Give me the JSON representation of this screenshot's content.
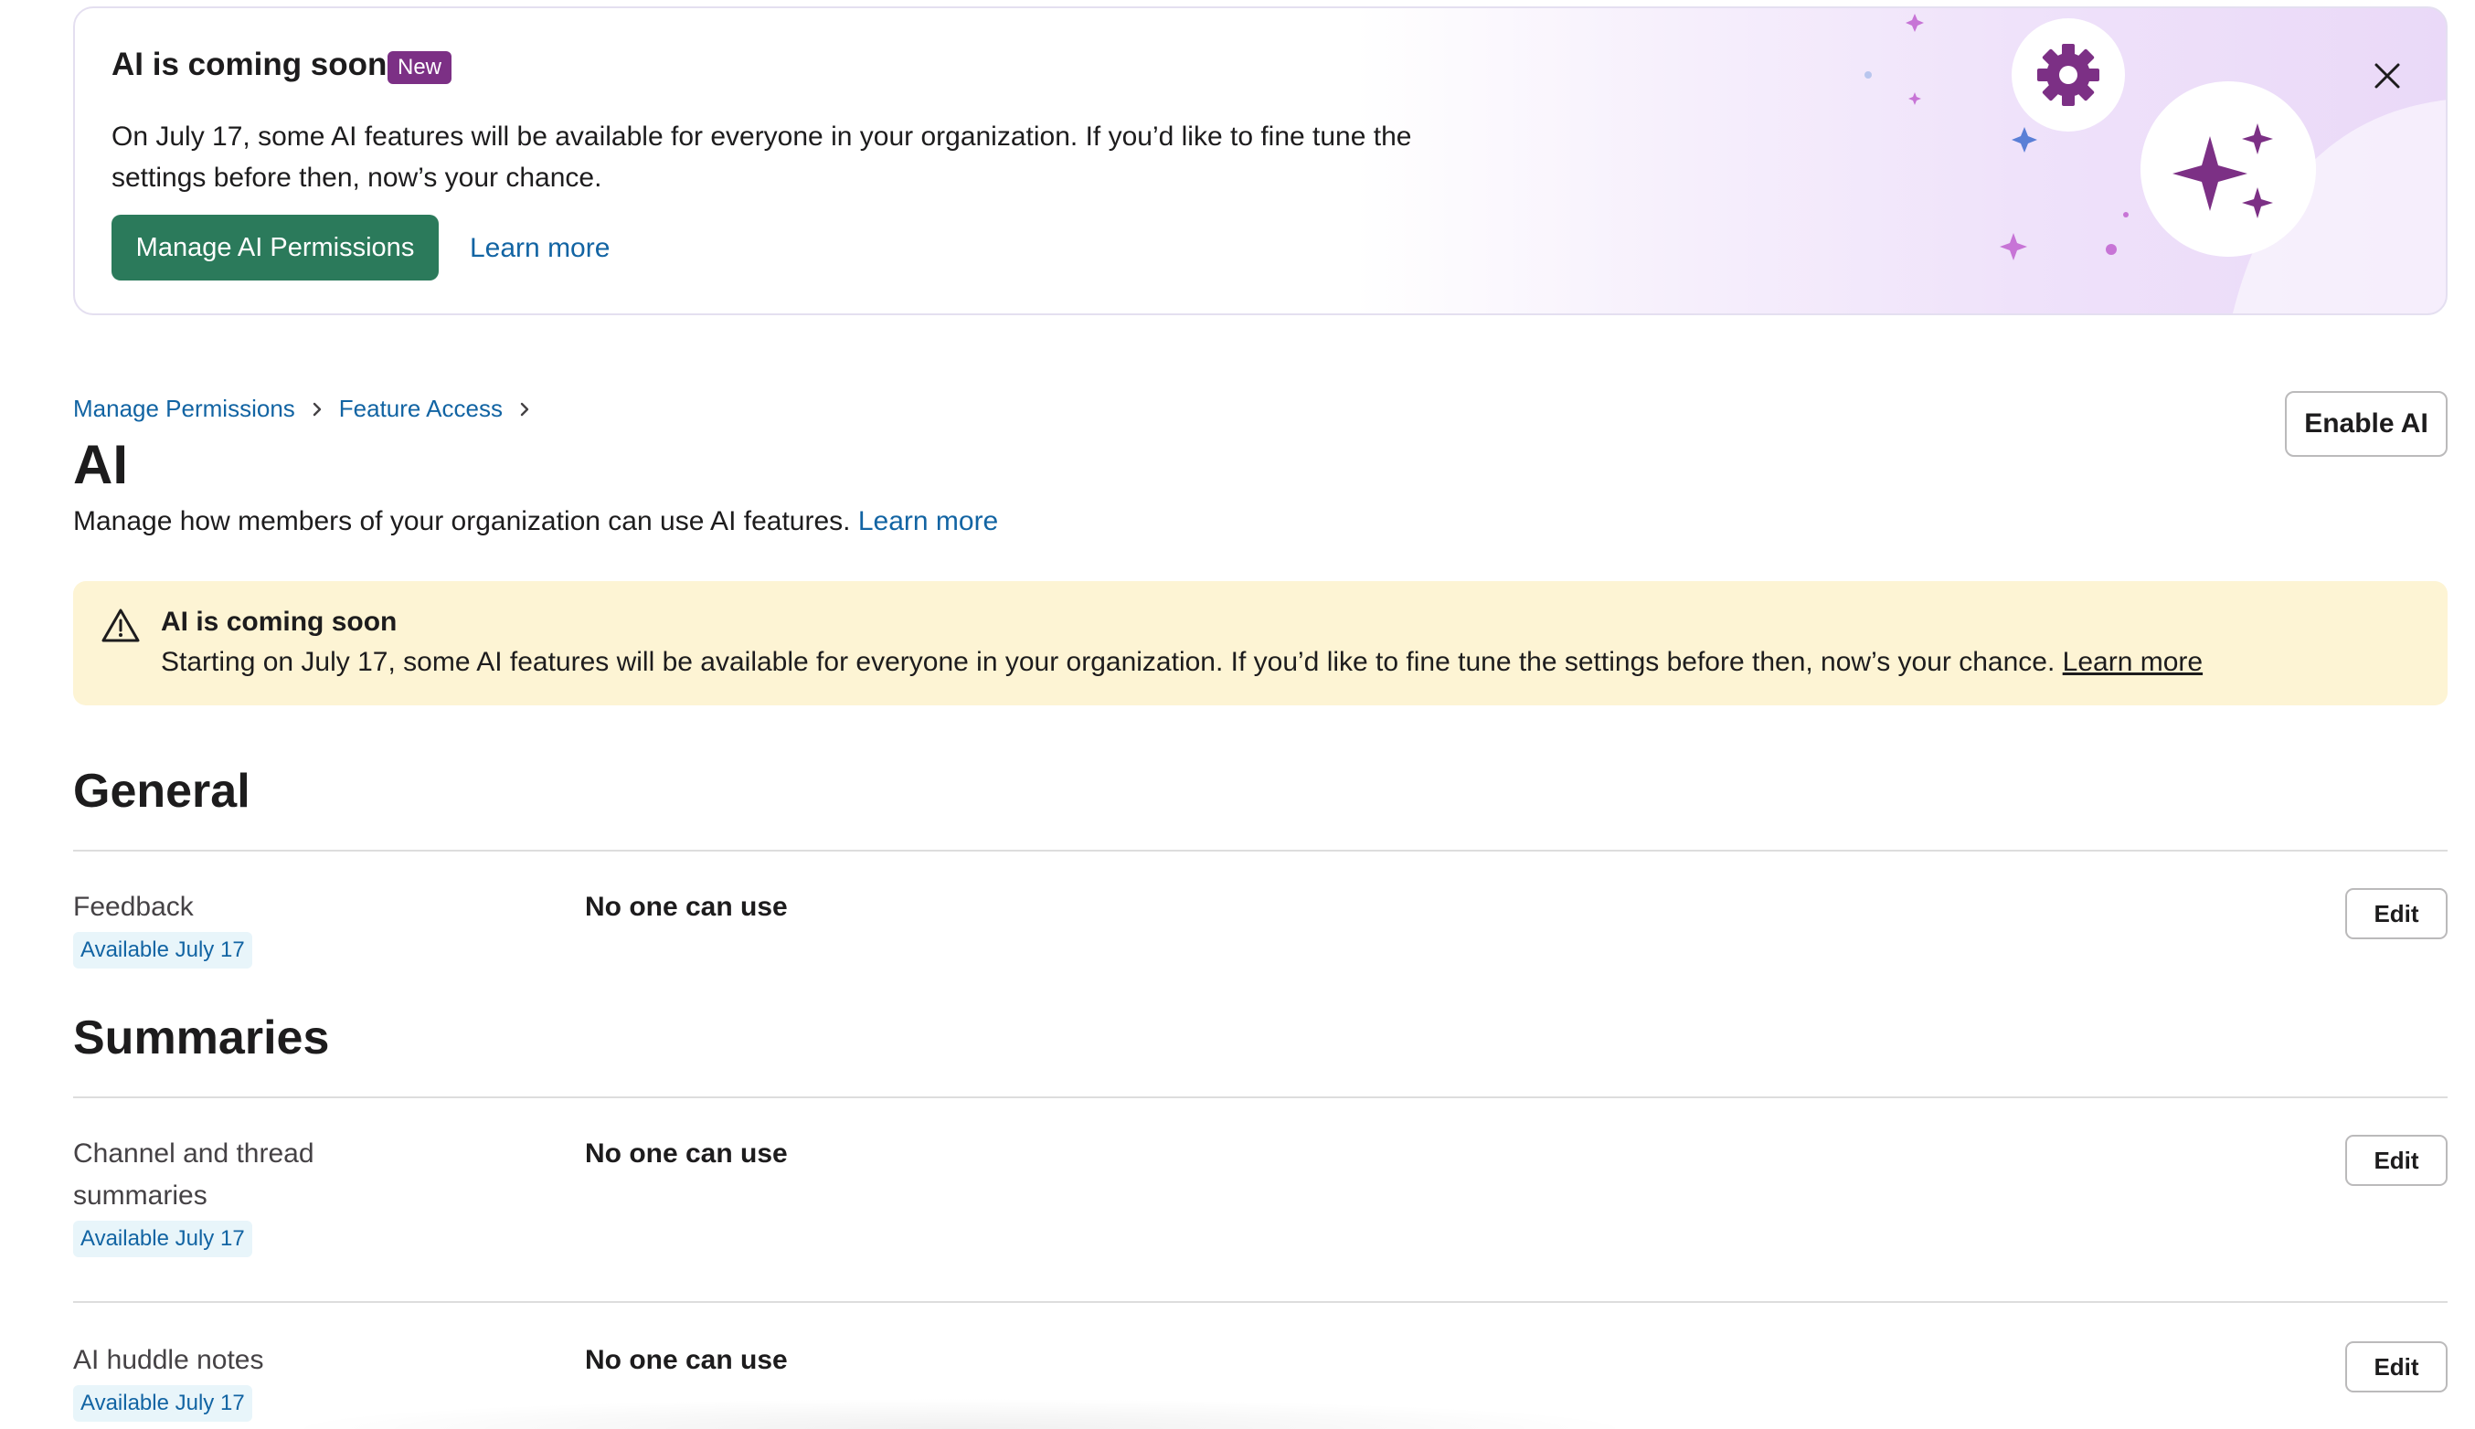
{
  "banner": {
    "title": "AI is coming soon",
    "badge": "New",
    "body": "On July 17, some AI features will be available for everyone in your organization. If you’d like to fine tune the settings before then, now’s your chance.",
    "manage_button": "Manage AI Permissions",
    "learn_more": "Learn more"
  },
  "breadcrumb": {
    "items": [
      "Manage Permissions",
      "Feature Access"
    ]
  },
  "page": {
    "title": "AI",
    "description": "Manage how members of your organization can use AI features.",
    "description_link": "Learn more",
    "enable_button": "Enable AI"
  },
  "warning": {
    "title": "AI is coming soon",
    "body": "Starting on July 17, some AI features will be available for everyone in your organization. If you’d like to fine tune the settings before then, now’s your chance.",
    "link": "Learn more"
  },
  "sections": {
    "general": {
      "title": "General",
      "rows": [
        {
          "name": "Feedback",
          "badge": "Available July 17",
          "value": "No one can use",
          "edit": "Edit"
        }
      ]
    },
    "summaries": {
      "title": "Summaries",
      "rows": [
        {
          "name": "Channel and thread summaries",
          "badge": "Available July 17",
          "value": "No one can use",
          "edit": "Edit"
        },
        {
          "name": "AI huddle notes",
          "badge": "Available July 17",
          "value": "No one can use",
          "edit": "Edit"
        }
      ]
    }
  },
  "colors": {
    "primary_button": "#2b7a5b",
    "link": "#1264a3",
    "badge_new": "#7c3085",
    "warning_bg": "#fdf4d4",
    "pill_bg": "#e8f5fa",
    "sparkle": "#7c3085"
  },
  "icons": {
    "close": "close-icon",
    "gear": "gear-icon",
    "sparkles": "sparkles-icon",
    "warning": "warning-icon",
    "chevron": "chevron-right-icon"
  }
}
